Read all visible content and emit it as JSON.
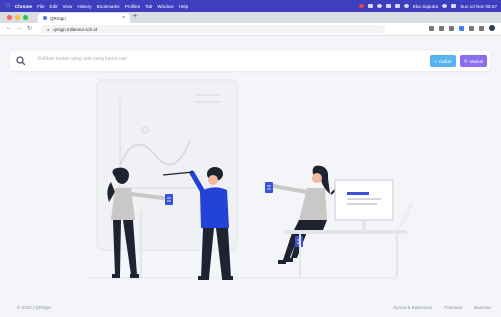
{
  "menubar": {
    "app": "Chrome",
    "items": [
      "File",
      "Edit",
      "View",
      "History",
      "Bookmarks",
      "Profiles",
      "Tab",
      "Window",
      "Help"
    ],
    "user": "Eka Saputra",
    "datetime": "Sun 13 Nov 08.57"
  },
  "browser": {
    "tab_title": "QRSign",
    "new_tab": "+",
    "tab_close": "×",
    "url": "qrsign.milannur.sch.id"
  },
  "header": {
    "search_placeholder": "Ketikan belum yang ada yang kamu cari",
    "register_label": "Daftar",
    "login_label": "Masuk",
    "register_color": "#57b4f0",
    "login_color": "#8a6df0"
  },
  "footer": {
    "copyright": "© 2022 | QRSign",
    "links": [
      "Syarat & Ketentuan",
      "Panduan",
      "Bantuan"
    ]
  }
}
